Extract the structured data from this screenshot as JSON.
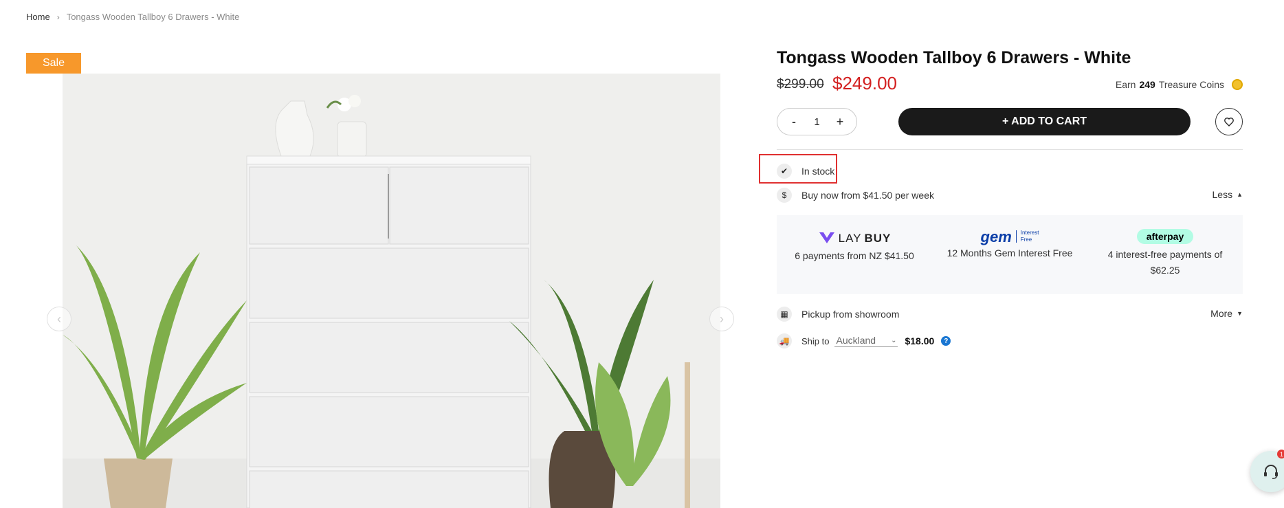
{
  "breadcrumb": {
    "home": "Home",
    "separator": "›",
    "current": "Tongass Wooden Tallboy 6 Drawers - White"
  },
  "gallery": {
    "sale_badge": "Sale",
    "prev_arrow": "‹",
    "next_arrow": "›"
  },
  "product": {
    "title": "Tongass Wooden Tallboy 6 Drawers - White",
    "old_price": "$299.00",
    "new_price": "$249.00",
    "coins_prefix": "Earn",
    "coins_amount": "249",
    "coins_suffix": "Treasure Coins"
  },
  "cart": {
    "minus": "-",
    "quantity": "1",
    "plus": "+",
    "add_to_cart": "+ ADD TO CART"
  },
  "stock": {
    "label": "In stock"
  },
  "payment": {
    "buy_now": "Buy now from $41.50 per week",
    "toggle_less": "Less",
    "laybuy": {
      "logo_light": "LAY",
      "logo_bold": "BUY",
      "text": "6 payments from NZ $41.50"
    },
    "gem": {
      "logo": "gem",
      "logo_small_1": "Interest",
      "logo_small_2": "Free",
      "text": "12 Months Gem Interest Free"
    },
    "afterpay": {
      "logo": "afterpay",
      "text_line1": "4 interest-free payments of",
      "text_line2": "$62.25"
    }
  },
  "pickup": {
    "label": "Pickup from showroom",
    "toggle_more": "More"
  },
  "shipping": {
    "label": "Ship to",
    "location": "Auckland",
    "price": "$18.00",
    "help": "?"
  },
  "support": {
    "badge_count": "1"
  },
  "colors": {
    "sale": "#f7982b",
    "price_red": "#d32020",
    "button_dark": "#1a1a1a",
    "highlight_box": "#e03030"
  }
}
